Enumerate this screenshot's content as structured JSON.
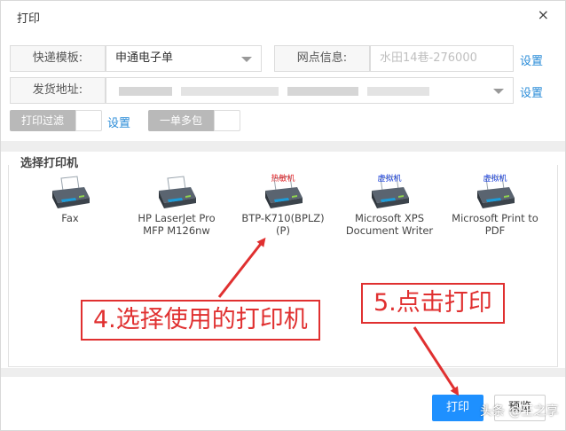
{
  "dialog": {
    "title": "打印",
    "close_icon": "×"
  },
  "form": {
    "template_label": "快递模板:",
    "template_value": "申通电子单",
    "outlet_label": "网点信息:",
    "outlet_value": "水田14巷-276000",
    "outlet_link": "设置",
    "address_label": "发货地址:",
    "address_link": "设置"
  },
  "toggles": {
    "print_filter_label": "打印过滤",
    "print_filter_link": "设置",
    "multi_package_label": "一单多包"
  },
  "printers": {
    "section_title": "选择打印机",
    "items": [
      {
        "name": "Fax",
        "tag": ""
      },
      {
        "name": "HP LaserJet Pro MFP M126nw",
        "tag": ""
      },
      {
        "name": "BTP-K710(BPLZ) (P)",
        "tag": "热敏机"
      },
      {
        "name": "Microsoft XPS Document Writer",
        "tag": "虚拟机"
      },
      {
        "name": "Microsoft Print to PDF",
        "tag": "虚拟机"
      }
    ]
  },
  "annotations": {
    "step4": "4.选择使用的打印机",
    "step5": "5.点击打印"
  },
  "buttons": {
    "print": "打印",
    "preview": "预览"
  },
  "watermark": "头条 @王之享",
  "colors": {
    "accent": "#1e90ff",
    "link": "#2a8cd8",
    "annotation": "#e03030"
  }
}
